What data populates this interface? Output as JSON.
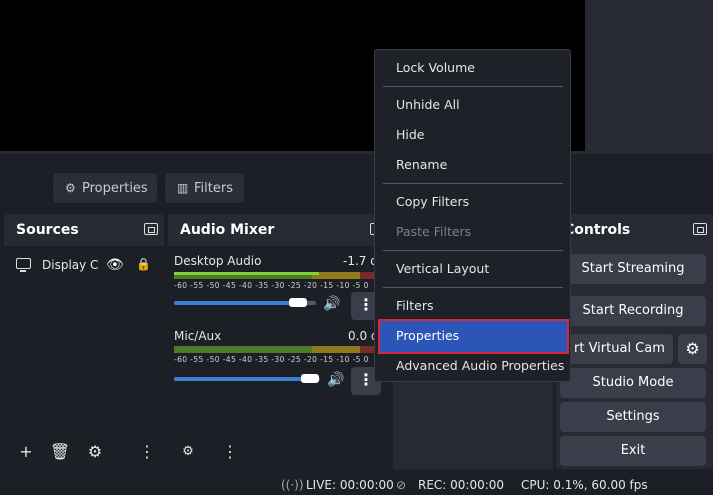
{
  "context_toolbar": {
    "properties_label": "Properties",
    "filters_label": "Filters"
  },
  "sources": {
    "title": "Sources",
    "items": [
      {
        "label": "Display C"
      }
    ]
  },
  "audio_mixer": {
    "title": "Audio Mixer",
    "tick_labels": "-60 -55 -50 -45 -40 -35 -30 -25 -20 -15 -10  -5   0",
    "channels": [
      {
        "name": "Desktop Audio",
        "db": "-1.7 d",
        "volume": 0.72
      },
      {
        "name": "Mic/Aux",
        "db": "0.0 d",
        "volume": 0.8
      }
    ]
  },
  "controls": {
    "title": "Controls",
    "buttons": {
      "start_streaming": "Start Streaming",
      "start_recording": "Start Recording",
      "start_virtual_cam": "rt Virtual Cam",
      "studio_mode": "Studio Mode",
      "settings": "Settings",
      "exit": "Exit"
    }
  },
  "context_menu": {
    "items": [
      {
        "label": "Lock Volume",
        "enabled": true
      },
      {
        "label": "Unhide All",
        "enabled": true
      },
      {
        "label": "Hide",
        "enabled": true
      },
      {
        "label": "Rename",
        "enabled": true
      },
      {
        "label": "Copy Filters",
        "enabled": true
      },
      {
        "label": "Paste Filters",
        "enabled": false
      },
      {
        "label": "Vertical Layout",
        "enabled": true
      },
      {
        "label": "Filters",
        "enabled": true
      },
      {
        "label": "Properties",
        "enabled": true,
        "highlighted": true
      },
      {
        "label": "Advanced Audio Properties",
        "enabled": true
      }
    ]
  },
  "status_bar": {
    "live": "LIVE: 00:00:00",
    "rec": "REC: 00:00:00",
    "cpu": "CPU: 0.1%, 60.00 fps"
  },
  "colors": {
    "background": "#1d1f26",
    "panel": "#272a33",
    "button": "#3a3e4a",
    "accent": "#3b7fd6",
    "menu_highlight": "#2b55b6",
    "highlight_border": "#d6283a"
  }
}
